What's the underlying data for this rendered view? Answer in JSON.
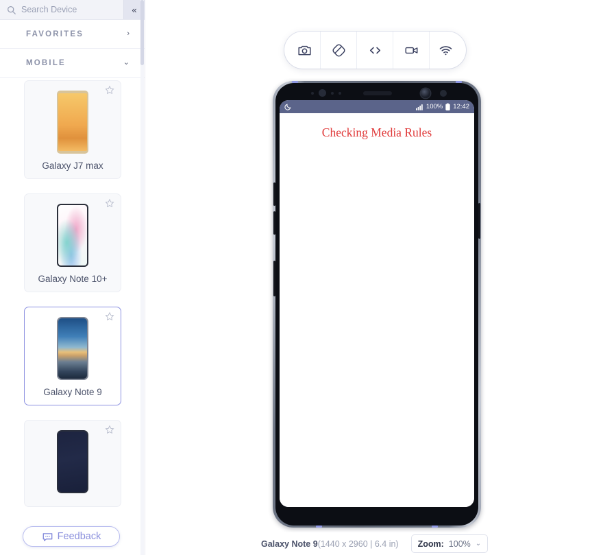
{
  "sidebar": {
    "search": {
      "placeholder": "Search Device",
      "value": "",
      "icon": "search-icon"
    },
    "collapse_label": "«",
    "sections": [
      {
        "title": "FAVORITES",
        "chevron": "›",
        "expanded": false
      },
      {
        "title": "MOBILE",
        "chevron": "⌄",
        "expanded": true
      }
    ],
    "devices": [
      {
        "name": "Galaxy J7 max",
        "selected": false,
        "favorite": false,
        "thumb": "gold-phone"
      },
      {
        "name": "Galaxy Note 10+",
        "selected": false,
        "favorite": false,
        "thumb": "white-swirl-phone"
      },
      {
        "name": "Galaxy Note 9",
        "selected": true,
        "favorite": false,
        "thumb": "blue-sunset-phone"
      },
      {
        "name": "",
        "selected": false,
        "favorite": false,
        "thumb": "dark-blue-phone"
      }
    ],
    "feedback": {
      "label": "Feedback",
      "icon": "chat-bubble-icon"
    }
  },
  "toolbar": {
    "buttons": [
      {
        "name": "screenshot-button",
        "icon": "camera-icon"
      },
      {
        "name": "rotate-button",
        "icon": "rotate-device-icon"
      },
      {
        "name": "devtools-button",
        "icon": "code-brackets-icon"
      },
      {
        "name": "record-button",
        "icon": "video-camera-icon"
      },
      {
        "name": "network-button",
        "icon": "wifi-icon"
      }
    ]
  },
  "device_preview": {
    "status_bar": {
      "dnd_icon": "crescent-moon-icon",
      "signal_icon": "signal-bars-icon",
      "battery_percent": "100%",
      "battery_icon": "battery-icon",
      "time": "12:42",
      "background": "#5b648a"
    },
    "page": {
      "heading": "Checking Media Rules",
      "heading_color": "#e03a3a"
    }
  },
  "bottom_bar": {
    "device_name": "Galaxy Note 9",
    "device_spec": "(1440 x 2960 | 6.4 in)",
    "zoom_label": "Zoom:",
    "zoom_value": "100%",
    "zoom_caret": "⌄"
  }
}
